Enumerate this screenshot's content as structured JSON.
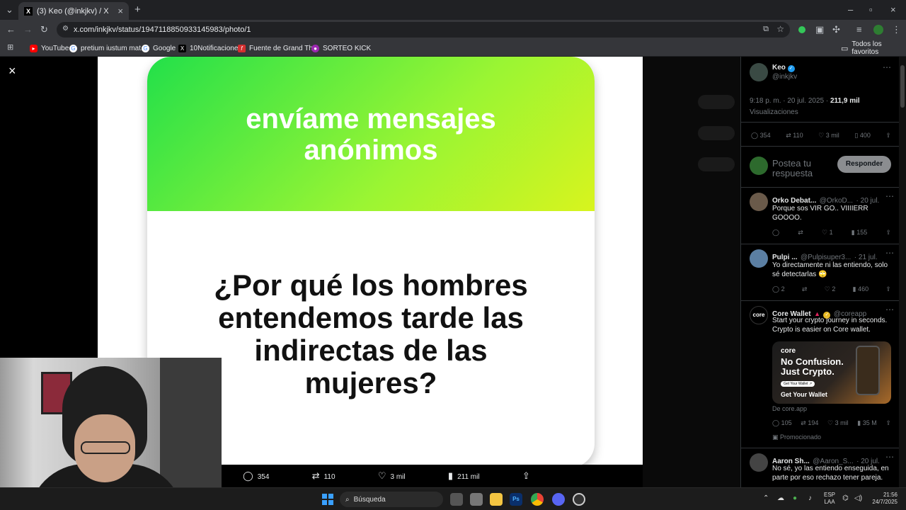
{
  "browser": {
    "tab_title": "(3) Keo (@inkjkv) / X",
    "url": "x.com/inkjkv/status/1947118850933145983/photo/1",
    "bookmarks": [
      {
        "label": "YouTube",
        "color": "#ff0000"
      },
      {
        "label": "pretium iustum mat...",
        "color": "#4285f4"
      },
      {
        "label": "Google",
        "color": "#4285f4"
      },
      {
        "label": "10Notificaciones",
        "color": "#000000"
      },
      {
        "label": "Fuente de Grand Th...",
        "color": "#d32f2f"
      },
      {
        "label": "SORTEO KICK",
        "color": "#9c27b0"
      }
    ],
    "all_favorites": "Todos los favoritos"
  },
  "photo": {
    "top_text_line1": "envíame mensajes",
    "top_text_line2": "anónimos",
    "question_line1": "¿Por qué los hombres",
    "question_line2": "entendemos tarde las",
    "question_line3": "indirectas de las",
    "question_line4": "mujeres?",
    "actions": {
      "replies": "354",
      "retweets": "110",
      "likes": "3 mil",
      "views": "211 mil"
    }
  },
  "tweet": {
    "author_name": "Keo",
    "author_handle": "@inkjkv",
    "timestamp": "9:18 p. m. · 20 jul. 2025 ·",
    "views_count": "211,9 mil",
    "views_label": "Visualizaciones",
    "replies": "354",
    "retweets": "110",
    "likes": "3 mil",
    "bookmarks": "400",
    "reply_placeholder_1": "Postea tu",
    "reply_placeholder_2": "respuesta",
    "reply_button": "Responder"
  },
  "replies": [
    {
      "name": "Orko Debat...",
      "handle": "@OrkoD...",
      "date": "· 20 jul.",
      "text_1": "Porque sos VIR GO.. VIIIIERR",
      "text_2": "GOOOO.",
      "likes": "1",
      "views": "155",
      "replies": "",
      "retweets": ""
    },
    {
      "name": "Pulpi ...",
      "handle": "@Pulpisuper3...",
      "date": "· 21 jul.",
      "text_1": "Yo directamente ni las entiendo, solo",
      "text_2": "sé detectarlas 🙄",
      "replies": "2",
      "likes": "2",
      "views": "460",
      "retweets": ""
    },
    {
      "name": "Aaron Sh...",
      "handle": "@Aaron_S...",
      "date": "· 20 jul.",
      "text_1": "No sé, yo las entiendo enseguida, en",
      "text_2": "parte por eso rechazo tener pareja."
    }
  ],
  "ad": {
    "name": "Core Wallet",
    "handle": "@coreapp",
    "text_1": "Start your crypto journey in seconds.",
    "text_2": "Crypto is easier on Core wallet.",
    "card_brand": "core",
    "card_line1": "No Confusion.",
    "card_line2": "Just Crypto.",
    "card_small_btn": "Get Your Wallet ↗",
    "card_cta": "Get Your Wallet",
    "source": "De core.app",
    "replies": "105",
    "retweets": "194",
    "likes": "3 mil",
    "views": "35 M",
    "promoted": "Promocionado",
    "avatar_text": "core"
  },
  "taskbar": {
    "search_placeholder": "Búsqueda",
    "lang_1": "ESP",
    "lang_2": "LAA",
    "time": "21:56",
    "date": "24/7/2025"
  }
}
